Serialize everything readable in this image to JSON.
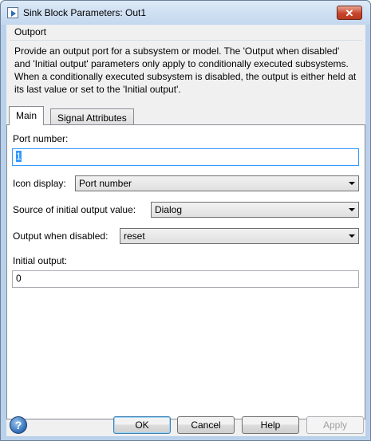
{
  "window": {
    "title": "Sink Block Parameters: Out1"
  },
  "group": {
    "title": "Outport",
    "description": "Provide an output port for a subsystem or model.  The 'Output when disabled' and 'Initial output' parameters only apply to conditionally executed subsystems. When a conditionally executed subsystem is disabled, the output is either held at its last value or set to the 'Initial output'."
  },
  "tabs": [
    {
      "label": "Main",
      "active": true
    },
    {
      "label": "Signal Attributes",
      "active": false
    }
  ],
  "main": {
    "port_number_label": "Port number:",
    "port_number_value": "1",
    "icon_display_label": "Icon display:",
    "icon_display_value": "Port number",
    "source_initial_label": "Source of initial output value:",
    "source_initial_value": "Dialog",
    "output_disabled_label": "Output when disabled:",
    "output_disabled_value": "reset",
    "initial_output_label": "Initial output:",
    "initial_output_value": "0"
  },
  "buttons": {
    "ok": "OK",
    "cancel": "Cancel",
    "help": "Help",
    "apply": "Apply"
  },
  "icons": {
    "help": "question-mark-icon",
    "close": "close-icon",
    "app": "simulink-block-icon"
  }
}
